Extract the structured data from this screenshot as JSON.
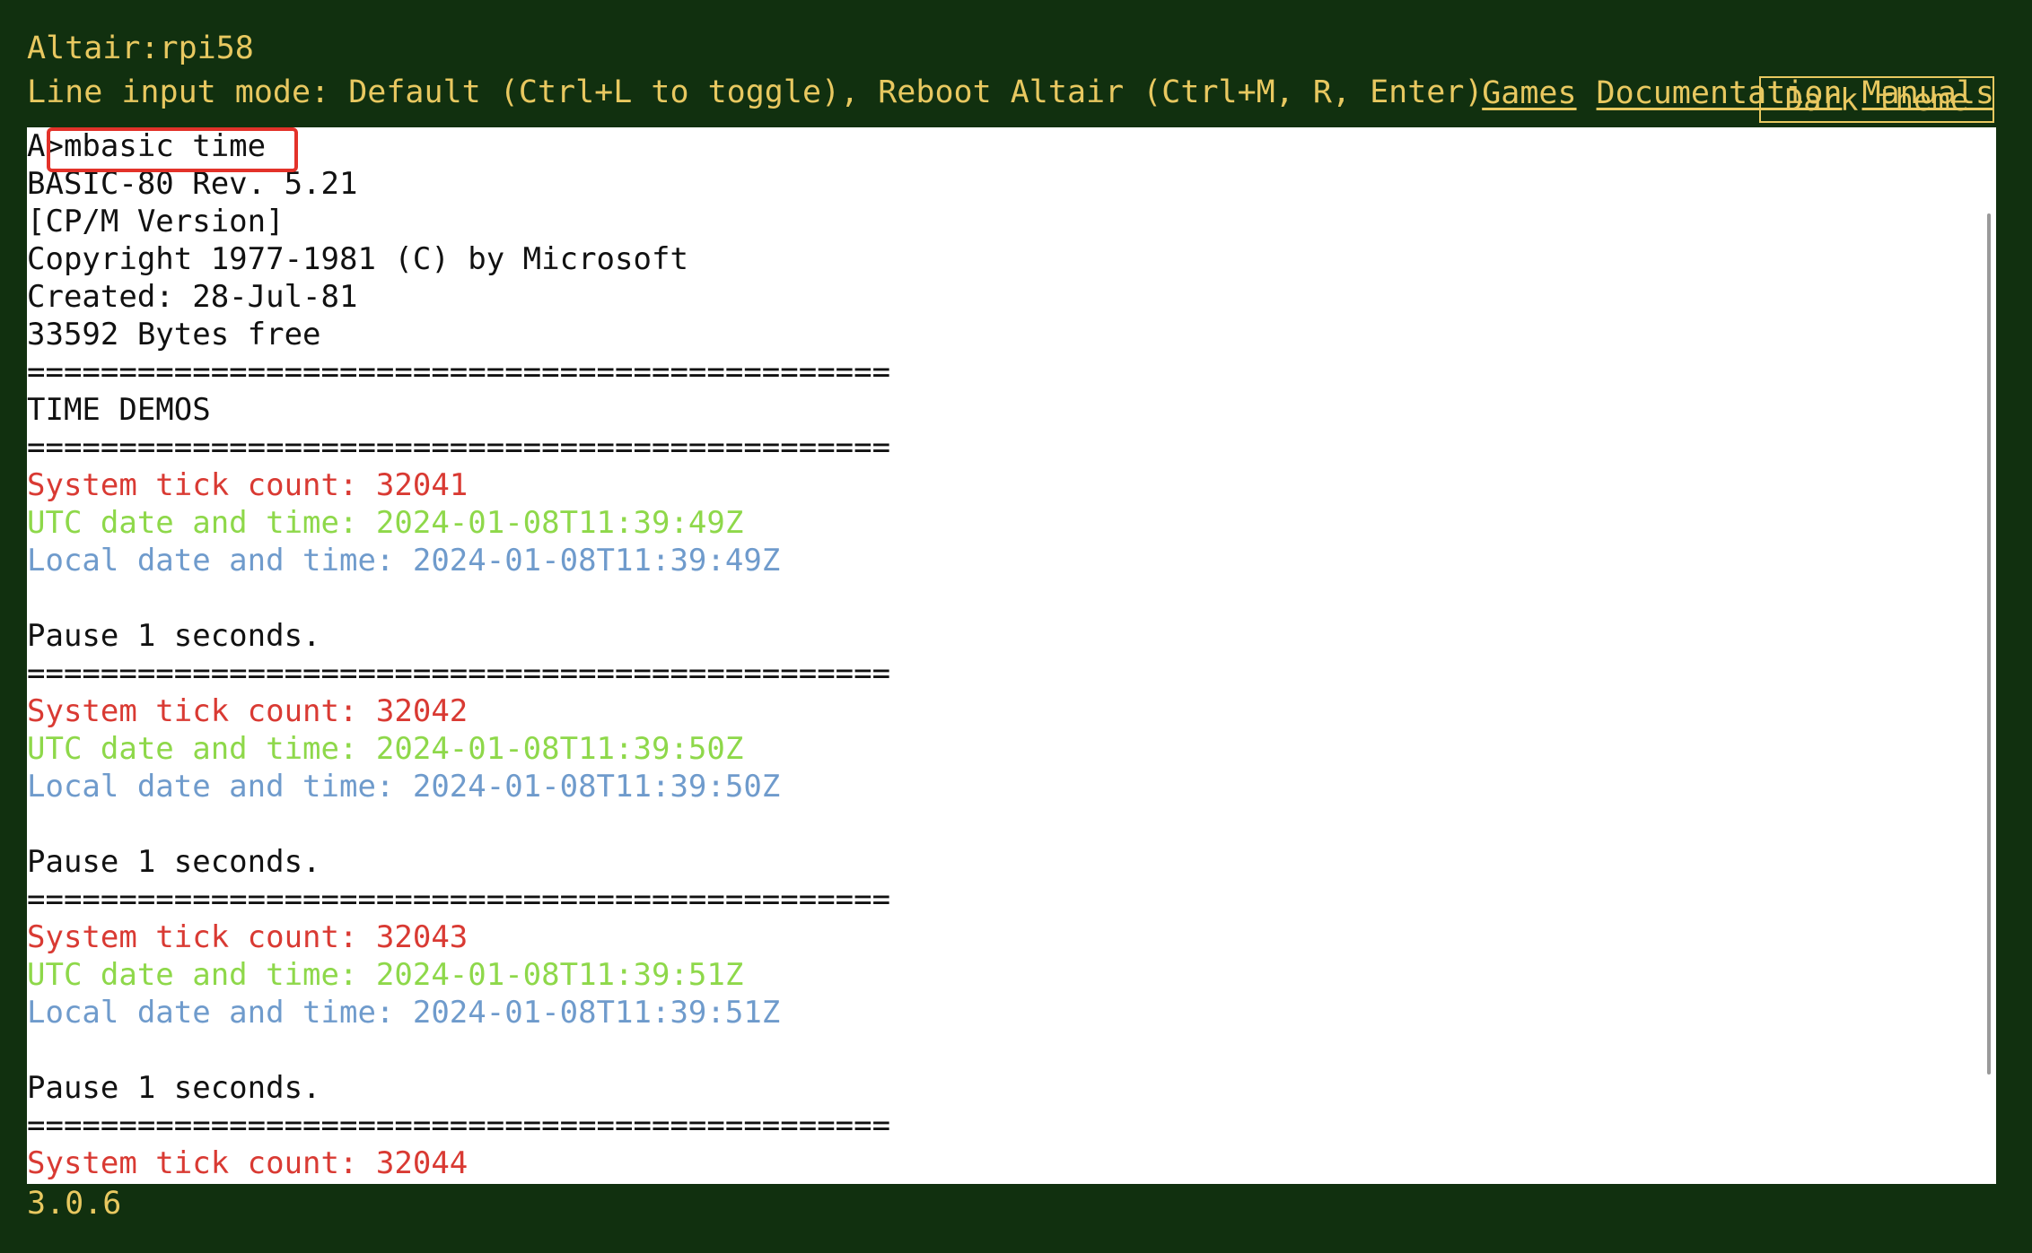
{
  "header": {
    "title": "Altair:rpi58",
    "mode_line": "Line input mode: Default (Ctrl+L to toggle), Reboot Altair (Ctrl+M, R, Enter)",
    "links": [
      "Games",
      "Documentation",
      "Manuals"
    ],
    "theme_button": "Dark theme"
  },
  "terminal": {
    "lines": [
      {
        "text": "A>mbasic time",
        "color": "black"
      },
      {
        "text": "BASIC-80 Rev. 5.21",
        "color": "black"
      },
      {
        "text": "[CP/M Version]",
        "color": "black"
      },
      {
        "text": "Copyright 1977-1981 (C) by Microsoft",
        "color": "black"
      },
      {
        "text": "Created: 28-Jul-81",
        "color": "black"
      },
      {
        "text": "33592 Bytes free",
        "color": "black"
      },
      {
        "text": "===============================================",
        "color": "black"
      },
      {
        "text": "TIME DEMOS",
        "color": "black"
      },
      {
        "text": "===============================================",
        "color": "black"
      },
      {
        "text": "System tick count: 32041",
        "color": "red"
      },
      {
        "text": "UTC date and time: 2024-01-08T11:39:49Z",
        "color": "green"
      },
      {
        "text": "Local date and time: 2024-01-08T11:39:49Z",
        "color": "blue"
      },
      {
        "text": "",
        "color": "black"
      },
      {
        "text": "Pause 1 seconds.",
        "color": "black"
      },
      {
        "text": "===============================================",
        "color": "black"
      },
      {
        "text": "System tick count: 32042",
        "color": "red"
      },
      {
        "text": "UTC date and time: 2024-01-08T11:39:50Z",
        "color": "green"
      },
      {
        "text": "Local date and time: 2024-01-08T11:39:50Z",
        "color": "blue"
      },
      {
        "text": "",
        "color": "black"
      },
      {
        "text": "Pause 1 seconds.",
        "color": "black"
      },
      {
        "text": "===============================================",
        "color": "black"
      },
      {
        "text": "System tick count: 32043",
        "color": "red"
      },
      {
        "text": "UTC date and time: 2024-01-08T11:39:51Z",
        "color": "green"
      },
      {
        "text": "Local date and time: 2024-01-08T11:39:51Z",
        "color": "blue"
      },
      {
        "text": "",
        "color": "black"
      },
      {
        "text": "Pause 1 seconds.",
        "color": "black"
      },
      {
        "text": "===============================================",
        "color": "black"
      },
      {
        "text": "System tick count: 32044",
        "color": "red"
      }
    ]
  },
  "footer": {
    "version": "3.0.6"
  },
  "colors": {
    "background": "#11300f",
    "accent": "#e8c860",
    "terminal_bg": "#ffffff",
    "red": "#d93a33",
    "green": "#8ed84a",
    "blue": "#6f9bcc",
    "highlight": "#e3322a"
  }
}
